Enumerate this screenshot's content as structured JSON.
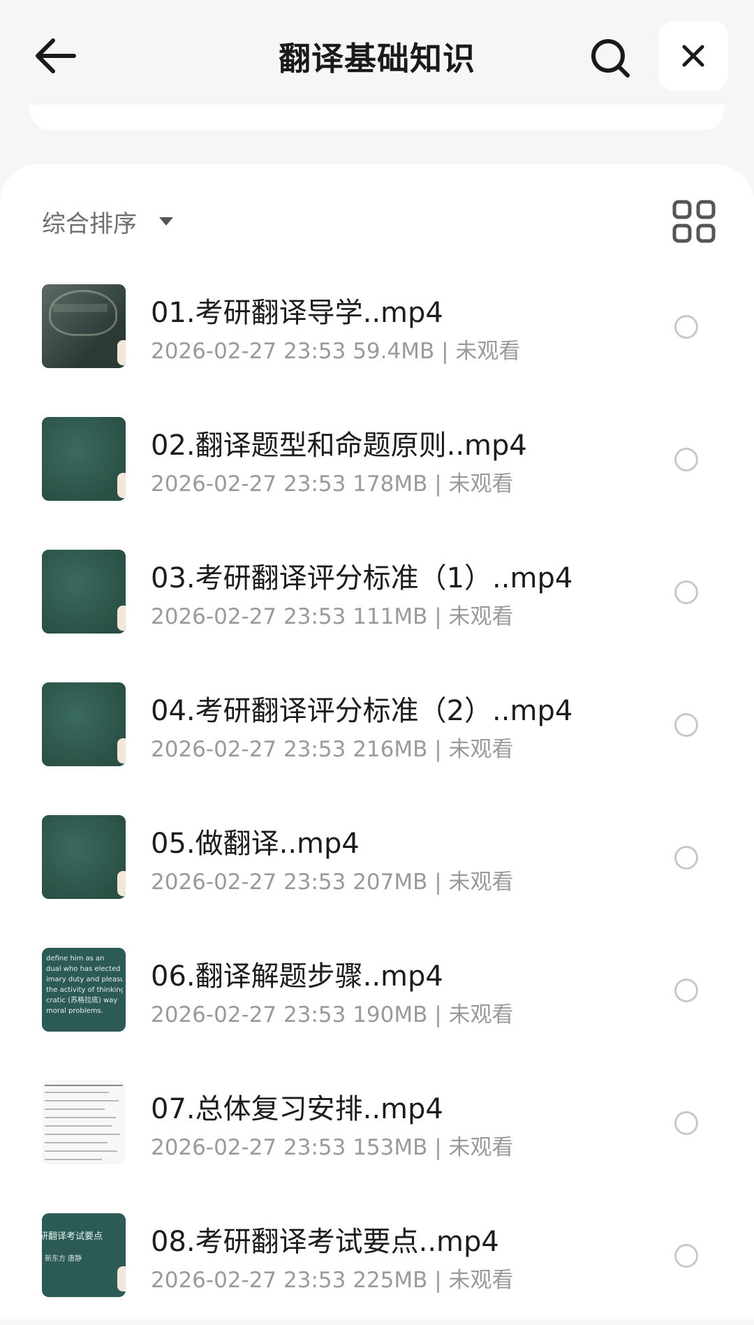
{
  "header": {
    "title": "翻译基础知识",
    "back_icon": "arrow-left-icon",
    "search_icon": "search-icon",
    "close_icon": "close-icon"
  },
  "toolbar": {
    "sort_label": "综合排序",
    "sort_icon": "caret-down-icon",
    "view_icon": "grid-view-icon"
  },
  "files": [
    {
      "name": "01.考研翻译导学..mp4",
      "meta": "2026-02-27 23:53  59.4MB | 未观看",
      "thumb_style": "photo"
    },
    {
      "name": "02.翻译题型和命题原则..mp4",
      "meta": "2026-02-27 23:53  178MB | 未观看",
      "thumb_style": "board"
    },
    {
      "name": "03.考研翻译评分标准（1）..mp4",
      "meta": "2026-02-27 23:53  111MB | 未观看",
      "thumb_style": "board"
    },
    {
      "name": "04.考研翻译评分标准（2）..mp4",
      "meta": "2026-02-27 23:53  216MB | 未观看",
      "thumb_style": "board"
    },
    {
      "name": "05.做翻译..mp4",
      "meta": "2026-02-27 23:53  207MB | 未观看",
      "thumb_style": "board"
    },
    {
      "name": "06.翻译解题步骤..mp4",
      "meta": "2026-02-27 23:53  190MB | 未观看",
      "thumb_style": "text"
    },
    {
      "name": "07.总体复习安排..mp4",
      "meta": "2026-02-27 23:53  153MB | 未观看",
      "thumb_style": "paper"
    },
    {
      "name": "08.考研翻译考试要点..mp4",
      "meta": "2026-02-27 23:53  225MB | 未观看",
      "thumb_style": "title"
    }
  ],
  "thumb_texts": {
    "item6": "define him as an\ndual who has elected as\nimary duty and pleasure\nthe activity of thinking\ncratic (苏格拉底) way\nmoral problems.",
    "item8a": "研翻译考试要点",
    "item8b": "新东方 唐静"
  },
  "colors": {
    "background": "#f6f6f6",
    "panel": "#ffffff",
    "meta_text": "#9a9a9a",
    "thumb_green": "#2f5a4f",
    "radio_border": "#c8c8c8"
  }
}
